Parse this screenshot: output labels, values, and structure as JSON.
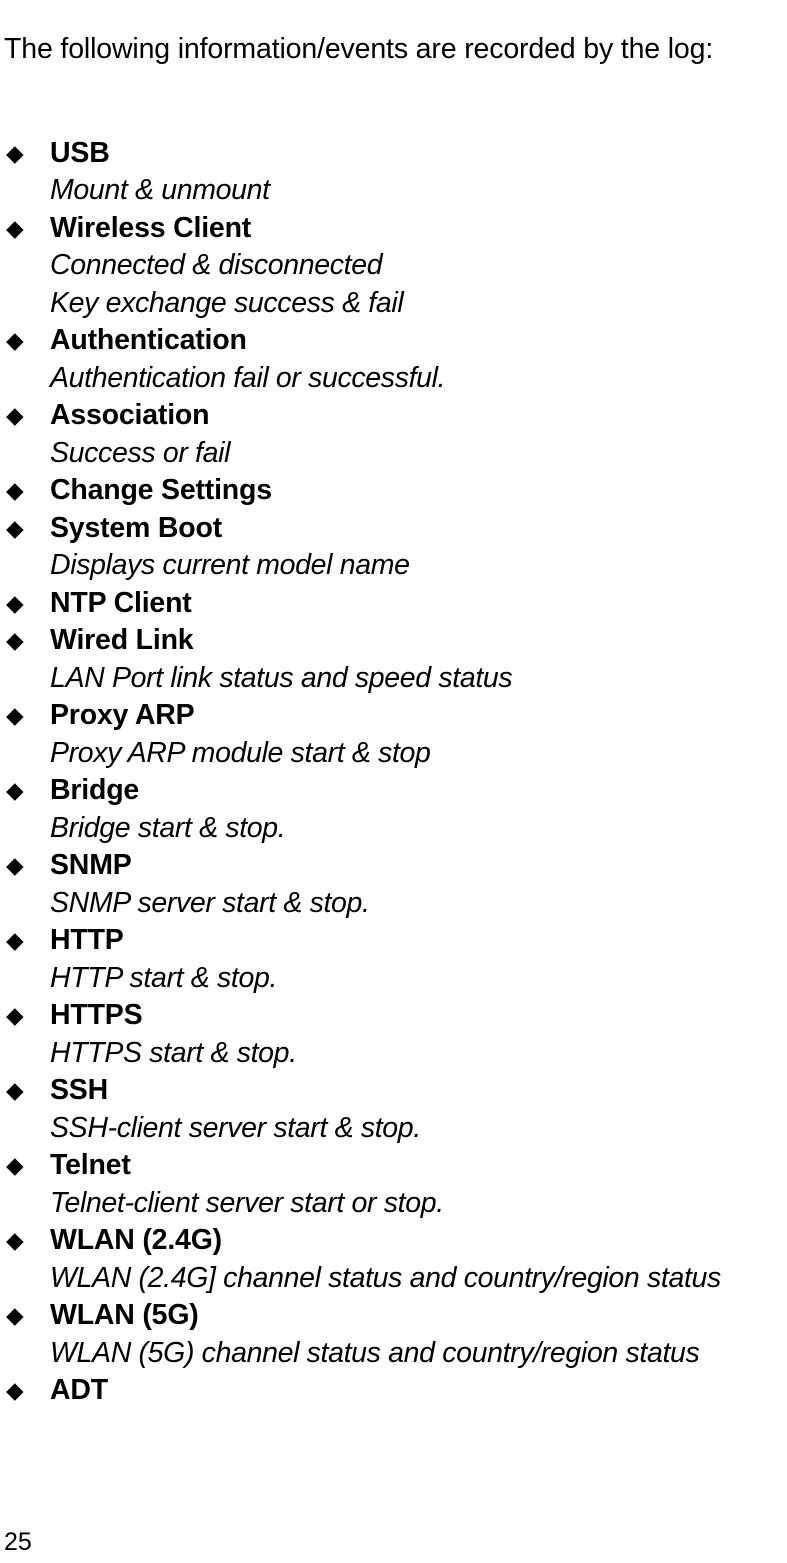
{
  "document": {
    "intro": "The following information/events are recorded by the log:",
    "bullet_glyph": "◆",
    "page_number": "25",
    "events": [
      {
        "title": "USB",
        "descriptions": [
          "Mount & unmount"
        ]
      },
      {
        "title": "Wireless Client",
        "descriptions": [
          "Connected & disconnected",
          "Key exchange success & fail"
        ]
      },
      {
        "title": "Authentication",
        "descriptions": [
          "Authentication fail or successful."
        ]
      },
      {
        "title": "Association",
        "descriptions": [
          "Success or fail"
        ]
      },
      {
        "title": "Change Settings",
        "descriptions": []
      },
      {
        "title": "System Boot",
        "descriptions": [
          "Displays current model name"
        ]
      },
      {
        "title": "NTP Client",
        "descriptions": []
      },
      {
        "title": "Wired Link",
        "descriptions": [
          "LAN Port link status and speed status"
        ]
      },
      {
        "title": "Proxy ARP",
        "descriptions": [
          "Proxy ARP module start & stop"
        ]
      },
      {
        "title": "Bridge",
        "descriptions": [
          "Bridge start & stop."
        ]
      },
      {
        "title": "SNMP",
        "descriptions": [
          "SNMP server start & stop."
        ]
      },
      {
        "title": "HTTP",
        "descriptions": [
          "HTTP start & stop."
        ]
      },
      {
        "title": "HTTPS",
        "descriptions": [
          "HTTPS start & stop."
        ]
      },
      {
        "title": "SSH",
        "descriptions": [
          "SSH-client server start & stop."
        ]
      },
      {
        "title": "Telnet",
        "descriptions": [
          "Telnet-client server start or stop."
        ]
      },
      {
        "title": "WLAN (2.4G)",
        "descriptions": [
          "WLAN (2.4G] channel status and country/region status"
        ]
      },
      {
        "title": "WLAN (5G)",
        "descriptions": [
          "WLAN (5G) channel status and country/region status"
        ]
      },
      {
        "title": "ADT",
        "descriptions": []
      }
    ]
  }
}
